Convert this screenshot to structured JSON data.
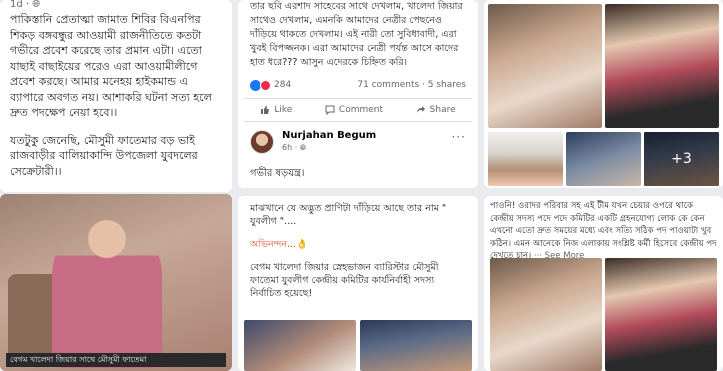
{
  "left_post": {
    "meta": "1d · ",
    "paragraph1": "পাকিস্তানি প্রেতাত্মা জামাত শিবির বিএনপির শিকড় বঙ্গবন্ধুর আওয়ামী রাজনীতিতে কতটা গভীরে প্রবেশ করেছে তার প্রমান এটা। এতো যাছাই বাছাইয়ের পরেও এরা আওয়ামীলীগে প্রবেশ করছে। আমার মনেহয় হাইকমান্ড এ ব্যাপারে অবগত নয়। আশাকরি ঘটনা সত্য হলে দ্রুত পদক্ষেপ নেয়া হবে।।",
    "paragraph2": "যতটুকু জেনেছি, মৌসুমী ফাতেমার বড় ভাই রাজবাড়ীর বালিয়াকান্দি উপজেলা যুবদলের সেক্রেটারী।।",
    "photo_caption": "বেগম খালেদা জিয়ার সাথে মৌসুমী ফাতেমা"
  },
  "mid_post": {
    "text_top": "তার ছবি এরশাদ সাহেবের সাথে দেখলাম, খালেদা জিয়ার সাথেও দেখলাম, এমনকি আমাদের নেত্রীর পেছনেও দাঁড়িয়ে থাকতে দেখলাম। এই নারী তো সুবিধাবাদী, এরা খুবই বিপজ্জনক। এরা আমাদের নেত্রী পর্যন্ত আসে কাদের হাত ধরে??? আসুন এদেরকে চিহ্নিত করি।",
    "reaction_count": "284",
    "comments": "71 comments",
    "shares": "5 shares",
    "like_label": "Like",
    "comment_label": "Comment",
    "share_label": "Share"
  },
  "second_post": {
    "author": "Nurjahan Begum",
    "time": "6h · ",
    "text": "গভীর ষড়যন্ত্র।"
  },
  "mid_bottom": {
    "line1": "মাঝখানে যে অদ্ভুত প্রাণিটা দাঁড়িয়ে আছে তার নাম \" যুবলীগ \"....",
    "line2": "অভিনন্দন...👌",
    "line3": "বেগম খালেদা জিয়ার স্নেহভাজন ব্যারিস্টার মৌসুমী ফাতেমা যুবলীগ কেন্দ্রীয় কমিটির কার্যনির্বাহী সদস্য নির্বাচিত হয়েছে!"
  },
  "right_top": {
    "more_count": "+3"
  },
  "right_bottom": {
    "text": "পাওনি! ওরাদর পরিবার সহ এই টীম যখন চেয়ার ওপরে থাকে কেন্দ্রীয় সদস্য পদে পদে কমিটির একটি গ্রহনযোগ্য লোক কে কেন এখনো এতো দ্রুত সময়ের মধ্যে এবং সত্যি সঠিক পদ পাওয়াটা খুব কঠিন। এমন আনেকে নিজ এলাকায় সংশ্লিষ্ট কর্মী হিসেবে কেন্দ্রীয় পদ দেখতে চান।",
    "see_more": "··· See More"
  }
}
